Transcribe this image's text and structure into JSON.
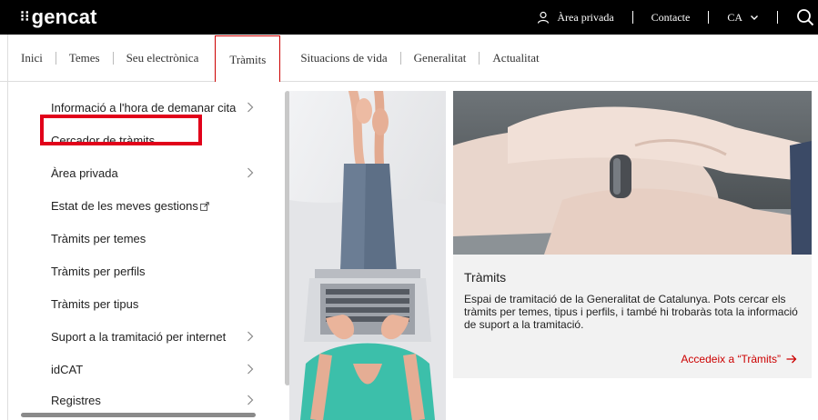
{
  "header": {
    "logo_mark": "⁝⁝",
    "logo_text": "gencat",
    "area_privada": "Àrea privada",
    "contacte": "Contacte",
    "language": "CA"
  },
  "nav": {
    "items": [
      "Inici",
      "Temes",
      "Seu electrònica",
      "Tràmits",
      "Situacions de vida",
      "Generalitat",
      "Actualitat"
    ],
    "active": "Tràmits"
  },
  "menu": {
    "items": [
      {
        "label": "Informació a l'hora de demanar cita",
        "chevron": true
      },
      {
        "label": "Cercador de tràmits",
        "chevron": false,
        "highlighted": true
      },
      {
        "label": "Àrea privada",
        "chevron": true
      },
      {
        "label": "Estat de les meves gestions",
        "chevron": false,
        "external": true
      },
      {
        "label": "Tràmits per temes",
        "chevron": false
      },
      {
        "label": "Tràmits per perfils",
        "chevron": false
      },
      {
        "label": "Tràmits per tipus",
        "chevron": false
      },
      {
        "label": "Suport a la tramitació per internet",
        "chevron": true
      },
      {
        "label": "idCAT",
        "chevron": true
      },
      {
        "label": "Registres",
        "chevron": true
      }
    ]
  },
  "card": {
    "title": "Tràmits",
    "text": "Espai de tramitació de la Generalitat de Catalunya. Pots cercar els tràmits per temes, tipus i perfils, i també hi trobaràs tota la informació de suport a la tramitació.",
    "link": "Accedeix a “Tràmits”"
  },
  "colors": {
    "accent": "#c00000",
    "highlight_box": "#e1001a",
    "topbar": "#000000"
  }
}
